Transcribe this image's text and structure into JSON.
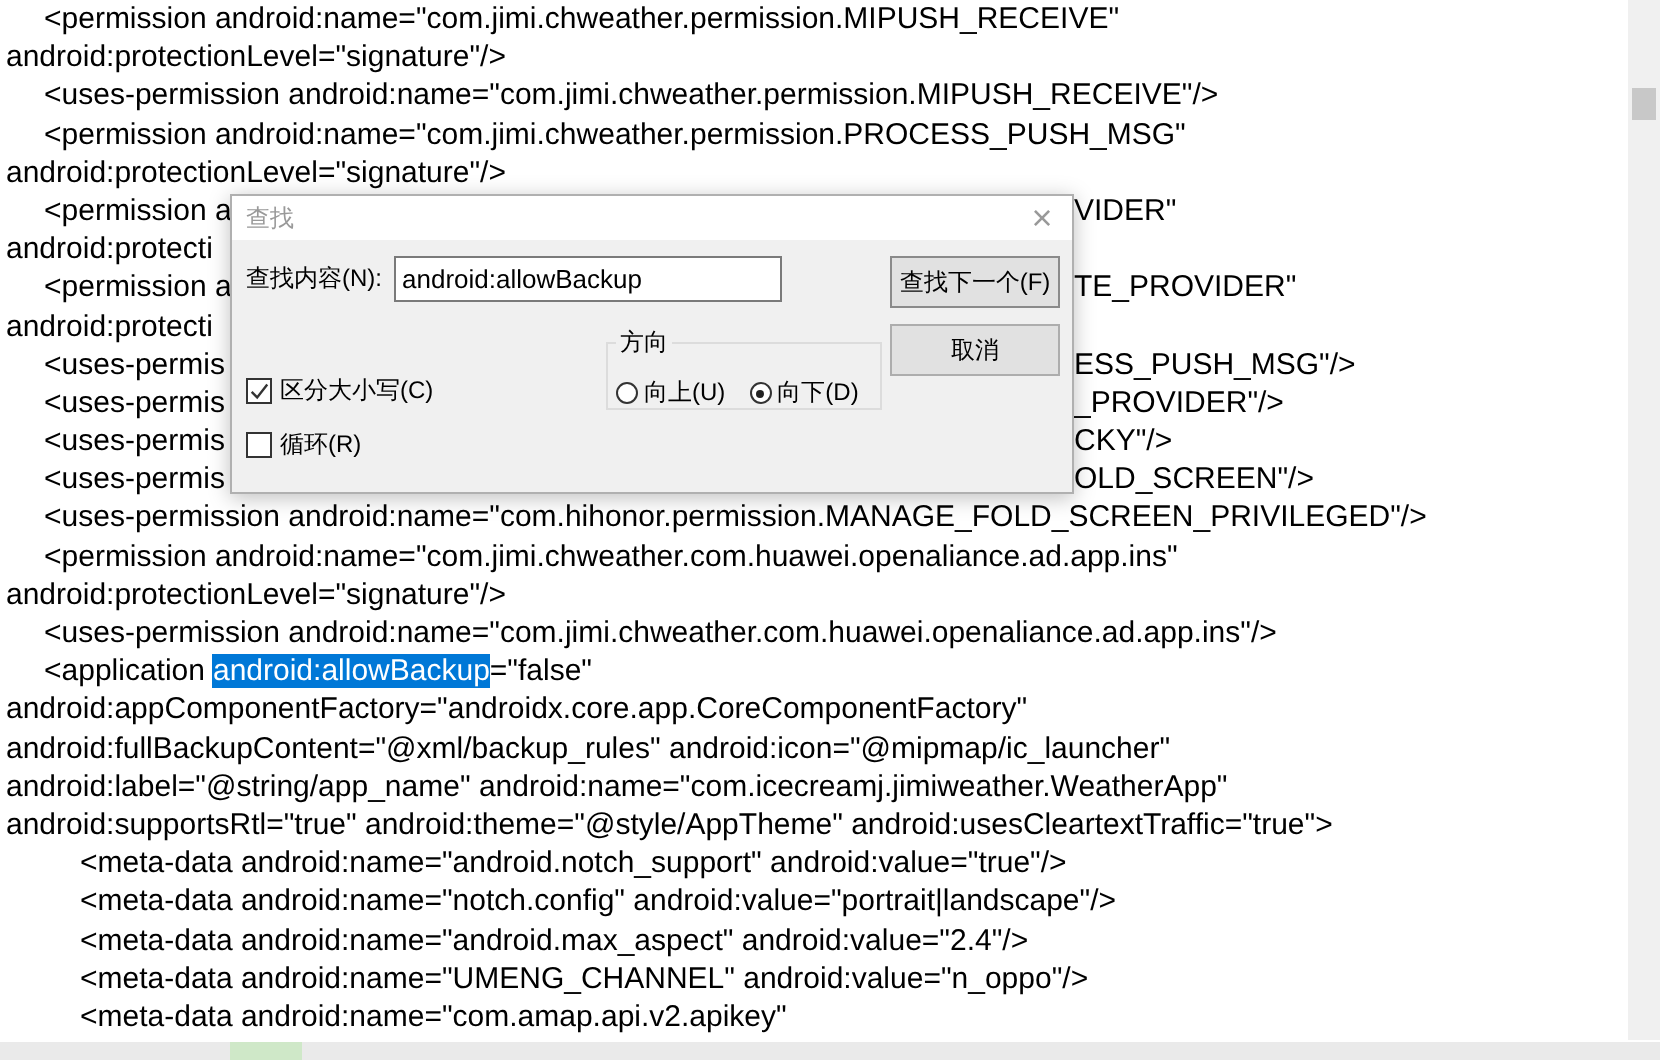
{
  "editor": {
    "lines": [
      {
        "kind": "element",
        "text": "<permission android:name=\"com.jimi.chweather.permission.MIPUSH_RECEIVE\""
      },
      {
        "kind": "continuation",
        "text": "android:protectionLevel=\"signature\"/>"
      },
      {
        "kind": "element",
        "text": "<uses-permission android:name=\"com.jimi.chweather.permission.MIPUSH_RECEIVE\"/>"
      },
      {
        "kind": "element",
        "text": "<permission android:name=\"com.jimi.chweather.permission.PROCESS_PUSH_MSG\""
      },
      {
        "kind": "continuation",
        "text": "android:protectionLevel=\"signature\"/>"
      },
      {
        "kind": "element",
        "text": "<permission a",
        "text_after_dialog": "VIDER\""
      },
      {
        "kind": "continuation",
        "text": "android:protecti"
      },
      {
        "kind": "element",
        "text": "<permission a",
        "text_after_dialog": "TE_PROVIDER\""
      },
      {
        "kind": "continuation",
        "text": "android:protecti"
      },
      {
        "kind": "element",
        "text": "<uses-permis",
        "text_after_dialog": "ESS_PUSH_MSG\"/>"
      },
      {
        "kind": "element",
        "text": "<uses-permis",
        "text_after_dialog": "_PROVIDER\"/>"
      },
      {
        "kind": "element",
        "text": "<uses-permis",
        "text_after_dialog": "CKY\"/>"
      },
      {
        "kind": "element",
        "text": "<uses-permis",
        "text_after_dialog": "OLD_SCREEN\"/>"
      },
      {
        "kind": "element",
        "text": "<uses-permission android:name=\"com.hihonor.permission.MANAGE_FOLD_SCREEN_PRIVILEGED\"/>"
      },
      {
        "kind": "element",
        "text": "<permission android:name=\"com.jimi.chweather.com.huawei.openaliance.ad.app.ins\""
      },
      {
        "kind": "continuation",
        "text": "android:protectionLevel=\"signature\"/>"
      },
      {
        "kind": "element",
        "text": "<uses-permission android:name=\"com.jimi.chweather.com.huawei.openaliance.ad.app.ins\"/>"
      },
      {
        "kind": "element",
        "segments": [
          {
            "text": "<application",
            "selected": false
          },
          {
            "text": "android:allowBackup",
            "selected": true
          },
          {
            "text": "=\"false\"",
            "selected": false
          }
        ]
      },
      {
        "kind": "continuation",
        "text": "android:appComponentFactory=\"androidx.core.app.CoreComponentFactory\""
      },
      {
        "kind": "continuation",
        "text": "android:fullBackupContent=\"@xml/backup_rules\" android:icon=\"@mipmap/ic_launcher\""
      },
      {
        "kind": "continuation",
        "text": "android:label=\"@string/app_name\" android:name=\"com.icecreamj.jimiweather.WeatherApp\""
      },
      {
        "kind": "continuation",
        "text": "android:supportsRtl=\"true\" android:theme=\"@style/AppTheme\" android:usesCleartextTraffic=\"true\">"
      },
      {
        "kind": "nested",
        "text": "<meta-data android:name=\"android.notch_support\" android:value=\"true\"/>"
      },
      {
        "kind": "nested",
        "text": "<meta-data android:name=\"notch.config\" android:value=\"portrait|landscape\"/>"
      },
      {
        "kind": "nested",
        "text": "<meta-data android:name=\"android.max_aspect\" android:value=\"2.4\"/>"
      },
      {
        "kind": "nested",
        "text": "<meta-data android:name=\"UMENG_CHANNEL\" android:value=\"n_oppo\"/>"
      },
      {
        "kind": "nested",
        "text": "<meta-data android:name=\"com.amap.api.v2.apikey\""
      }
    ]
  },
  "find_dialog": {
    "title": "查找",
    "close": "×",
    "find_label": "查找内容(N):",
    "find_value": "android:allowBackup",
    "buttons": [
      {
        "label": "查找下一个(F)",
        "kind": "default"
      },
      {
        "label": "取消",
        "kind": "normal"
      }
    ],
    "options": [
      {
        "label": "区分大小写(C)",
        "checked": true
      },
      {
        "label": "循环(R)",
        "checked": false
      }
    ],
    "direction": {
      "label": "方向",
      "choices": [
        {
          "label": "向上(U)",
          "selected": false
        },
        {
          "label": "向下(D)",
          "selected": true
        }
      ]
    }
  }
}
